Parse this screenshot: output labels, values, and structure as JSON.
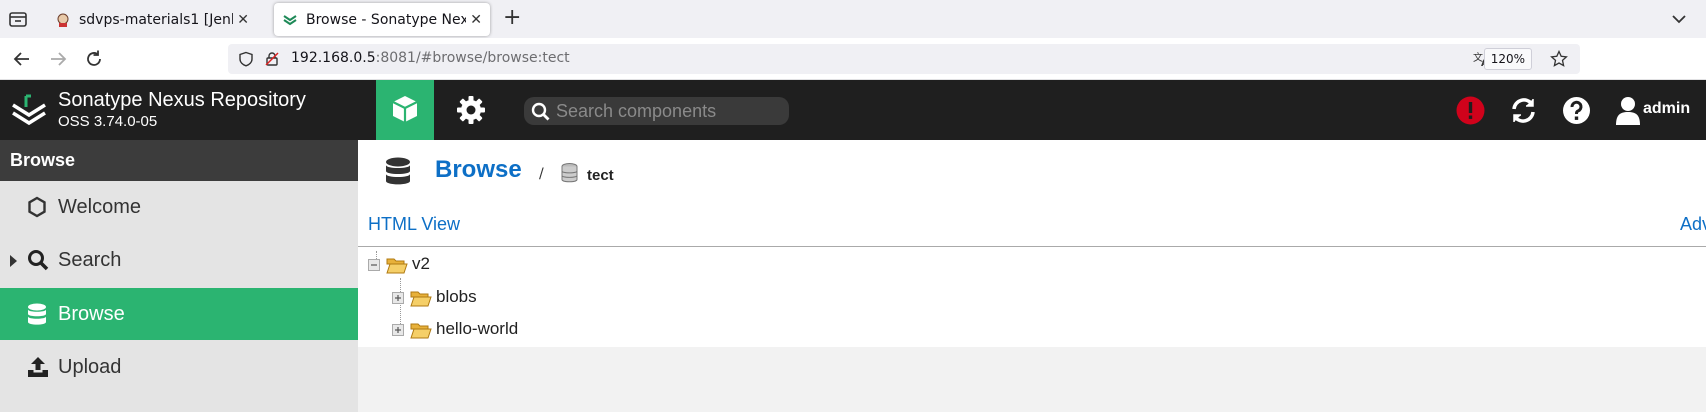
{
  "browser": {
    "tabs": [
      {
        "title": "sdvps-materials1 [Jenkins]",
        "active": false,
        "favicon": "jenkins-icon"
      },
      {
        "title": "Browse - Sonatype Nexus Repository",
        "active": true,
        "favicon": "nexus-icon"
      }
    ],
    "url_host": "192.168.0.5",
    "url_rest": ":8081/#browse/browse:tect",
    "zoom": "120%"
  },
  "header": {
    "product": "Sonatype Nexus Repository",
    "version": "OSS 3.74.0-05",
    "search_placeholder": "Search components",
    "username": "admin"
  },
  "sidebar": {
    "title": "Browse",
    "items": [
      {
        "label": "Welcome",
        "icon": "hexagon-icon",
        "active": false
      },
      {
        "label": "Search",
        "icon": "magnifier-icon",
        "active": false,
        "expandable": true
      },
      {
        "label": "Browse",
        "icon": "database-icon",
        "active": true
      },
      {
        "label": "Upload",
        "icon": "upload-icon",
        "active": false
      }
    ]
  },
  "main": {
    "breadcrumb_root": "Browse",
    "breadcrumb_sep": "/",
    "repository": "tect",
    "html_view": "HTML View",
    "advanced": "Adv",
    "tree": [
      {
        "name": "v2",
        "expanded": true,
        "level": 0
      },
      {
        "name": "blobs",
        "expanded": false,
        "level": 1
      },
      {
        "name": "hello-world",
        "expanded": false,
        "level": 1
      }
    ]
  },
  "colors": {
    "accent_green": "#2bb471",
    "link_blue": "#0d6fc6",
    "header_bg": "#1f1f1f",
    "alert_red": "#d0021b"
  }
}
